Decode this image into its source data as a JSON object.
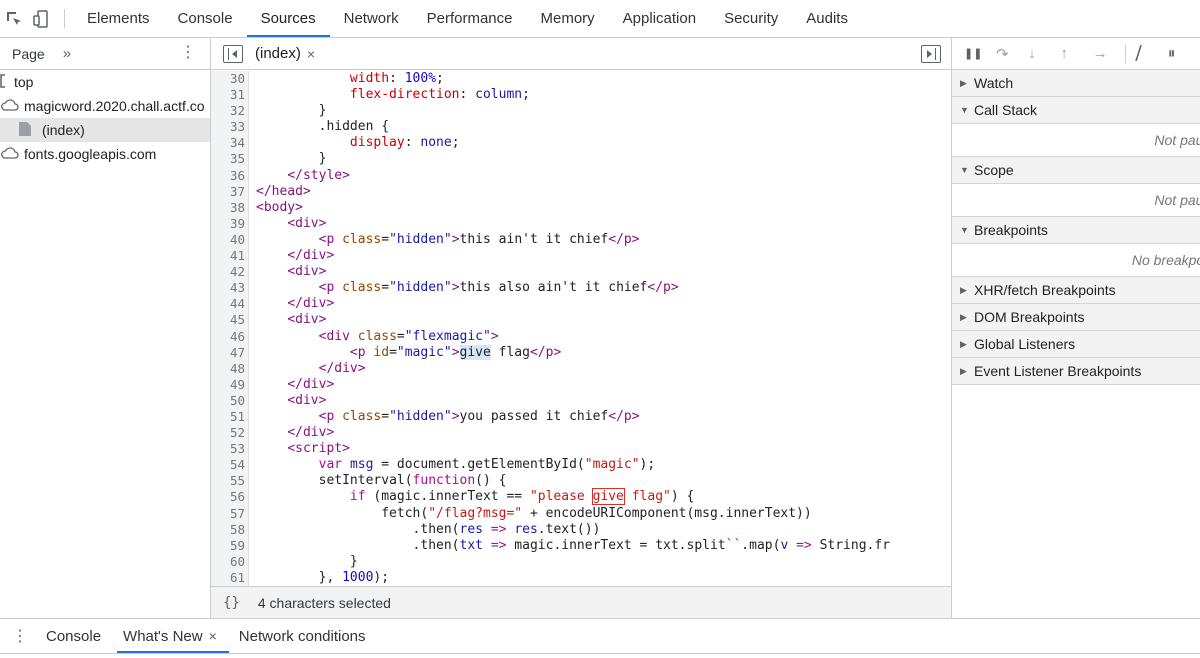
{
  "topbar": {
    "icons": [
      "select-element-icon",
      "device-toolbar-icon"
    ],
    "tabs": [
      "Elements",
      "Console",
      "Sources",
      "Network",
      "Performance",
      "Memory",
      "Application",
      "Security",
      "Audits"
    ],
    "active_tab": "Sources"
  },
  "navigator": {
    "tab_label": "Page",
    "more_label": "»",
    "kebab": "⋮",
    "items": [
      {
        "label": "top",
        "icon": "frame-icon"
      },
      {
        "label": "magicword.2020.chall.actf.co",
        "icon": "cloud-icon"
      },
      {
        "label": "(index)",
        "icon": "file-icon",
        "selected": true
      },
      {
        "label": "fonts.googleapis.com",
        "icon": "cloud-icon"
      }
    ]
  },
  "editor": {
    "file_tab": "(index)",
    "close": "×",
    "status_pretty": "{}",
    "status_text": "4 characters selected",
    "code_lines": [
      {
        "n": "30",
        "indent": "            ",
        "parts": [
          [
            "prop",
            "width"
          ],
          [
            "plain",
            ": "
          ],
          [
            "num",
            "100%"
          ],
          [
            "plain",
            ";"
          ]
        ]
      },
      {
        "n": "31",
        "indent": "            ",
        "parts": [
          [
            "prop",
            "flex-direction"
          ],
          [
            "plain",
            ": "
          ],
          [
            "def",
            "column"
          ],
          [
            "plain",
            ";"
          ]
        ]
      },
      {
        "n": "32",
        "indent": "        ",
        "parts": [
          [
            "plain",
            "}"
          ]
        ]
      },
      {
        "n": "33",
        "indent": "        ",
        "parts": [
          [
            "plain",
            ".hidden {"
          ]
        ]
      },
      {
        "n": "34",
        "indent": "            ",
        "parts": [
          [
            "prop",
            "display"
          ],
          [
            "plain",
            ": "
          ],
          [
            "def",
            "none"
          ],
          [
            "plain",
            ";"
          ]
        ]
      },
      {
        "n": "35",
        "indent": "        ",
        "parts": [
          [
            "plain",
            "}"
          ]
        ]
      },
      {
        "n": "36",
        "indent": "    ",
        "parts": [
          [
            "tag",
            "</style>"
          ]
        ]
      },
      {
        "n": "37",
        "indent": "",
        "parts": [
          [
            "tag",
            "</head>"
          ]
        ]
      },
      {
        "n": "38",
        "indent": "",
        "parts": [
          [
            "tag",
            "<body>"
          ]
        ]
      },
      {
        "n": "39",
        "indent": "    ",
        "parts": [
          [
            "tag",
            "<div>"
          ]
        ]
      },
      {
        "n": "40",
        "indent": "        ",
        "parts": [
          [
            "tag",
            "<p "
          ],
          [
            "attr",
            "class"
          ],
          [
            "plain",
            "="
          ],
          [
            "val",
            "\"hidden\""
          ],
          [
            "tag",
            ">"
          ],
          [
            "plain",
            "this ain't it chief"
          ],
          [
            "tag",
            "</p>"
          ]
        ]
      },
      {
        "n": "41",
        "indent": "    ",
        "parts": [
          [
            "tag",
            "</div>"
          ]
        ]
      },
      {
        "n": "42",
        "indent": "    ",
        "parts": [
          [
            "tag",
            "<div>"
          ]
        ]
      },
      {
        "n": "43",
        "indent": "        ",
        "parts": [
          [
            "tag",
            "<p "
          ],
          [
            "attr",
            "class"
          ],
          [
            "plain",
            "="
          ],
          [
            "val",
            "\"hidden\""
          ],
          [
            "tag",
            ">"
          ],
          [
            "plain",
            "this also ain't it chief"
          ],
          [
            "tag",
            "</p>"
          ]
        ]
      },
      {
        "n": "44",
        "indent": "    ",
        "parts": [
          [
            "tag",
            "</div>"
          ]
        ]
      },
      {
        "n": "45",
        "indent": "    ",
        "parts": [
          [
            "tag",
            "<div>"
          ]
        ]
      },
      {
        "n": "46",
        "indent": "        ",
        "parts": [
          [
            "tag",
            "<div "
          ],
          [
            "attr",
            "class"
          ],
          [
            "plain",
            "="
          ],
          [
            "val",
            "\"flexmagic\""
          ],
          [
            "tag",
            ">"
          ]
        ]
      },
      {
        "n": "47",
        "indent": "            ",
        "parts": [
          [
            "tag",
            "<p "
          ],
          [
            "attr",
            "id"
          ],
          [
            "plain",
            "="
          ],
          [
            "val",
            "\"magic\""
          ],
          [
            "tag",
            ">"
          ],
          [
            "hl",
            "give"
          ],
          [
            "plain",
            " flag"
          ],
          [
            "tag",
            "</p>"
          ]
        ]
      },
      {
        "n": "48",
        "indent": "        ",
        "parts": [
          [
            "tag",
            "</div>"
          ]
        ]
      },
      {
        "n": "49",
        "indent": "    ",
        "parts": [
          [
            "tag",
            "</div>"
          ]
        ]
      },
      {
        "n": "50",
        "indent": "    ",
        "parts": [
          [
            "tag",
            "<div>"
          ]
        ]
      },
      {
        "n": "51",
        "indent": "        ",
        "parts": [
          [
            "tag",
            "<p "
          ],
          [
            "attr",
            "class"
          ],
          [
            "plain",
            "="
          ],
          [
            "val",
            "\"hidden\""
          ],
          [
            "tag",
            ">"
          ],
          [
            "plain",
            "you passed it chief"
          ],
          [
            "tag",
            "</p>"
          ]
        ]
      },
      {
        "n": "52",
        "indent": "    ",
        "parts": [
          [
            "tag",
            "</div>"
          ]
        ]
      },
      {
        "n": "53",
        "indent": "    ",
        "parts": [
          [
            "tag",
            "<script>"
          ]
        ]
      },
      {
        "n": "54",
        "indent": "        ",
        "parts": [
          [
            "kw",
            "var"
          ],
          [
            "plain",
            " "
          ],
          [
            "def",
            "msg"
          ],
          [
            "plain",
            " = document.getElementById("
          ],
          [
            "str",
            "\"magic\""
          ],
          [
            "plain",
            ");"
          ]
        ]
      },
      {
        "n": "55",
        "indent": "        ",
        "parts": [
          [
            "plain",
            "setInterval("
          ],
          [
            "kw",
            "function"
          ],
          [
            "plain",
            "() {"
          ]
        ]
      },
      {
        "n": "56",
        "indent": "            ",
        "parts": [
          [
            "kw",
            "if"
          ],
          [
            "plain",
            " (magic.innerText == "
          ],
          [
            "str",
            "\"please "
          ],
          [
            "strbox",
            "give"
          ],
          [
            "str",
            " flag\""
          ],
          [
            "plain",
            ") {"
          ]
        ]
      },
      {
        "n": "57",
        "indent": "                ",
        "parts": [
          [
            "plain",
            "fetch("
          ],
          [
            "str",
            "\"/flag?msg=\""
          ],
          [
            "plain",
            " + encodeURIComponent(msg.innerText))"
          ]
        ]
      },
      {
        "n": "58",
        "indent": "                    ",
        "parts": [
          [
            "plain",
            ".then("
          ],
          [
            "def",
            "res"
          ],
          [
            "plain",
            " "
          ],
          [
            "kw",
            "=>"
          ],
          [
            "plain",
            " "
          ],
          [
            "def",
            "res"
          ],
          [
            "plain",
            ".text())"
          ]
        ]
      },
      {
        "n": "59",
        "indent": "                    ",
        "parts": [
          [
            "plain",
            ".then("
          ],
          [
            "def",
            "txt"
          ],
          [
            "plain",
            " "
          ],
          [
            "kw",
            "=>"
          ],
          [
            "plain",
            " magic.innerText = txt.split"
          ],
          [
            "str",
            "``"
          ],
          [
            "plain",
            ".map("
          ],
          [
            "def",
            "v"
          ],
          [
            "plain",
            " "
          ],
          [
            "kw",
            "=>"
          ],
          [
            "plain",
            " String.fr"
          ]
        ]
      },
      {
        "n": "60",
        "indent": "            ",
        "parts": [
          [
            "plain",
            "}"
          ]
        ]
      },
      {
        "n": "61",
        "indent": "        ",
        "parts": [
          [
            "plain",
            "}, "
          ],
          [
            "num",
            "1000"
          ],
          [
            "plain",
            ");"
          ]
        ]
      }
    ]
  },
  "debugger": {
    "controls": [
      {
        "icon": "pause-icon",
        "glyph": "❚❚"
      },
      {
        "icon": "step-over-icon",
        "glyph": "↷"
      },
      {
        "icon": "step-into-icon",
        "glyph": "↓"
      },
      {
        "icon": "step-out-icon",
        "glyph": "↑"
      },
      {
        "icon": "step-icon",
        "glyph": "→"
      }
    ],
    "extra_controls": [
      {
        "icon": "deactivate-breakpoints-icon",
        "glyph": "⧸"
      },
      {
        "icon": "pause-on-exceptions-icon",
        "glyph": "⏸"
      }
    ],
    "sections": [
      {
        "title": "Watch",
        "expanded": false
      },
      {
        "title": "Call Stack",
        "expanded": true,
        "body": "Not paused"
      },
      {
        "title": "Scope",
        "expanded": true,
        "body": "Not paused"
      },
      {
        "title": "Breakpoints",
        "expanded": true,
        "body": "No breakpoints"
      },
      {
        "title": "XHR/fetch Breakpoints",
        "expanded": false
      },
      {
        "title": "DOM Breakpoints",
        "expanded": false
      },
      {
        "title": "Global Listeners",
        "expanded": false
      },
      {
        "title": "Event Listener Breakpoints",
        "expanded": false
      }
    ]
  },
  "drawer": {
    "kebab": "⋮",
    "tabs": [
      {
        "label": "Console",
        "active": false,
        "closable": false
      },
      {
        "label": "What's New",
        "active": true,
        "closable": true
      },
      {
        "label": "Network conditions",
        "active": false,
        "closable": false
      }
    ],
    "close": "×"
  },
  "colors": {
    "accent": "#1a73e8",
    "border": "#cbcdd1",
    "selection_highlight": "#d6e6f5",
    "box_outline": "#d93025"
  }
}
